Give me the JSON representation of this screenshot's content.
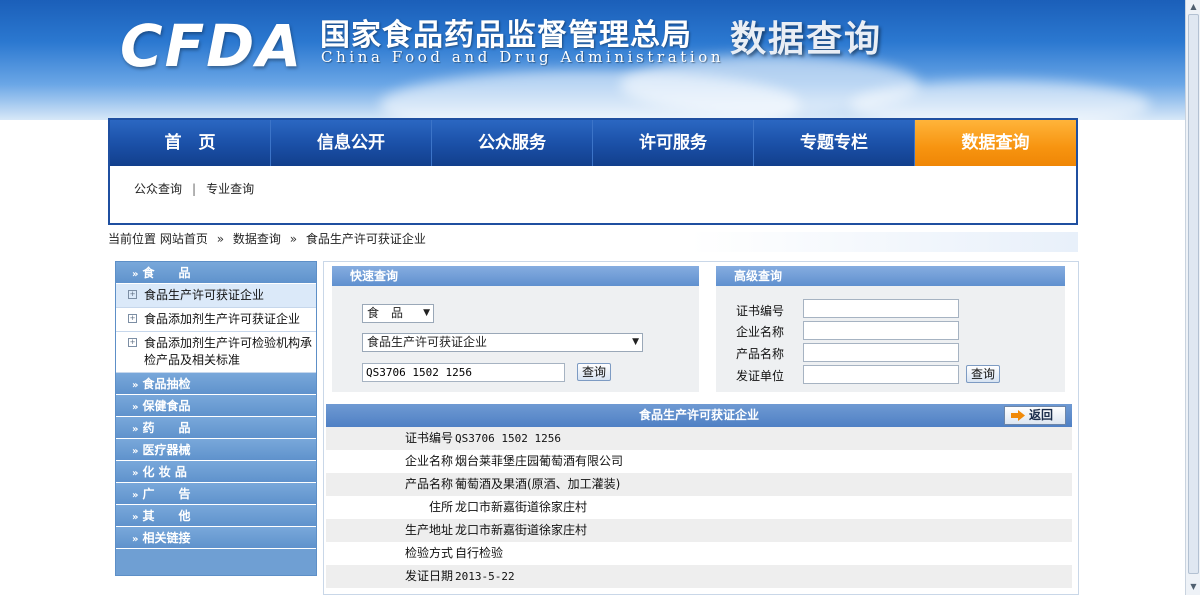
{
  "header": {
    "logo": "CFDA",
    "cn_title": "国家食品药品监督管理总局",
    "en_title": "China Food and Drug Administration",
    "section_title": "数据查询"
  },
  "nav": {
    "items": [
      {
        "label": "首　页"
      },
      {
        "label": "信息公开"
      },
      {
        "label": "公众服务"
      },
      {
        "label": "许可服务"
      },
      {
        "label": "专题专栏"
      },
      {
        "label": "数据查询",
        "active": true
      }
    ],
    "sub": [
      "公众查询",
      "专业查询"
    ]
  },
  "breadcrumb": {
    "prefix": "当前位置",
    "items": [
      "网站首页",
      "数据查询",
      "食品生产许可获证企业"
    ]
  },
  "sidebar": {
    "categories": [
      {
        "label": "食　　品",
        "subs": [
          "食品生产许可获证企业",
          "食品添加剂生产许可获证企业",
          "食品添加剂生产许可检验机构承检产品及相关标准"
        ]
      },
      {
        "label": "食品抽检"
      },
      {
        "label": "保健食品"
      },
      {
        "label": "药　　品"
      },
      {
        "label": "医疗器械"
      },
      {
        "label": "化 妆 品"
      },
      {
        "label": "广　　告"
      },
      {
        "label": "其　　他"
      },
      {
        "label": "相关链接"
      }
    ]
  },
  "quick": {
    "title": "快速查询",
    "category_select": "食　品",
    "type_select": "食品生产许可获证企业",
    "query_value": "QS3706 1502 1256",
    "button": "查询"
  },
  "advanced": {
    "title": "高级查询",
    "fields": [
      "证书编号",
      "企业名称",
      "产品名称",
      "发证单位"
    ],
    "button": "查询"
  },
  "result": {
    "title": "食品生产许可获证企业",
    "back_label": "返回",
    "rows": [
      {
        "k": "证书编号",
        "v": "QS3706 1502 1256"
      },
      {
        "k": "企业名称",
        "v": "烟台莱菲堡庄园葡萄酒有限公司"
      },
      {
        "k": "产品名称",
        "v": "葡萄酒及果酒(原酒、加工灌装)"
      },
      {
        "k": "住所",
        "v": "龙口市新嘉街道徐家庄村"
      },
      {
        "k": "生产地址",
        "v": "龙口市新嘉街道徐家庄村"
      },
      {
        "k": "检验方式",
        "v": "自行检验"
      },
      {
        "k": "发证日期",
        "v": "2013-5-22"
      }
    ]
  },
  "colors": {
    "nav_blue": "#1a4fa6",
    "nav_active": "#f79410",
    "panel_blue": "#5f90cf"
  }
}
